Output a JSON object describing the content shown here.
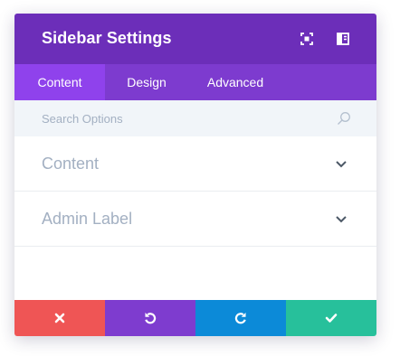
{
  "header": {
    "title": "Sidebar Settings",
    "expand_icon": "expand-icon",
    "columns_icon": "columns-icon"
  },
  "tabs": [
    {
      "label": "Content",
      "active": true
    },
    {
      "label": "Design",
      "active": false
    },
    {
      "label": "Advanced",
      "active": false
    }
  ],
  "search": {
    "placeholder": "Search Options",
    "value": "",
    "icon": "search-icon"
  },
  "sections": [
    {
      "label": "Content",
      "icon": "chevron-down-icon"
    },
    {
      "label": "Admin Label",
      "icon": "chevron-down-icon"
    }
  ],
  "footer": {
    "buttons": [
      {
        "name": "cancel",
        "icon": "close-icon",
        "color": "#ef5555"
      },
      {
        "name": "undo",
        "icon": "undo-icon",
        "color": "#7e3ccf"
      },
      {
        "name": "redo",
        "icon": "redo-icon",
        "color": "#0c8ad8"
      },
      {
        "name": "save",
        "icon": "check-icon",
        "color": "#27c09b"
      }
    ]
  },
  "colors": {
    "header_bg": "#6c2eb9",
    "tabs_bg": "#7d3bcf",
    "active_tab_bg": "#8f42ec",
    "search_bg": "#f1f5f9",
    "muted_text": "#a3b0c2"
  }
}
